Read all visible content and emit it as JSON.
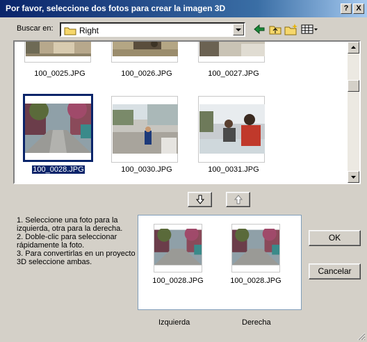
{
  "window": {
    "title": "Por favor, seleccione dos fotos para crear la imagen 3D",
    "help_label": "?",
    "close_label": "X"
  },
  "toolbar": {
    "look_in_label": "Buscar en:",
    "look_in_value": "Right"
  },
  "files": [
    {
      "name": "100_0025.JPG",
      "selected": false
    },
    {
      "name": "100_0026.JPG",
      "selected": false
    },
    {
      "name": "100_0027.JPG",
      "selected": false
    },
    {
      "name": "100_0028.JPG",
      "selected": true
    },
    {
      "name": "100_0030.JPG",
      "selected": false
    },
    {
      "name": "100_0031.JPG",
      "selected": false
    }
  ],
  "instructions": "1. Seleccione una foto para la izquierda, otra para la derecha.\n2. Doble-clic para seleccionar rápidamente la foto.\n3. Para convertirlas en un proyecto 3D seleccione ambas.",
  "preview": {
    "left_file": "100_0028.JPG",
    "right_file": "100_0028.JPG",
    "left_label": "Izquierda",
    "right_label": "Derecha"
  },
  "buttons": {
    "ok": "OK",
    "cancel": "Cancelar"
  }
}
